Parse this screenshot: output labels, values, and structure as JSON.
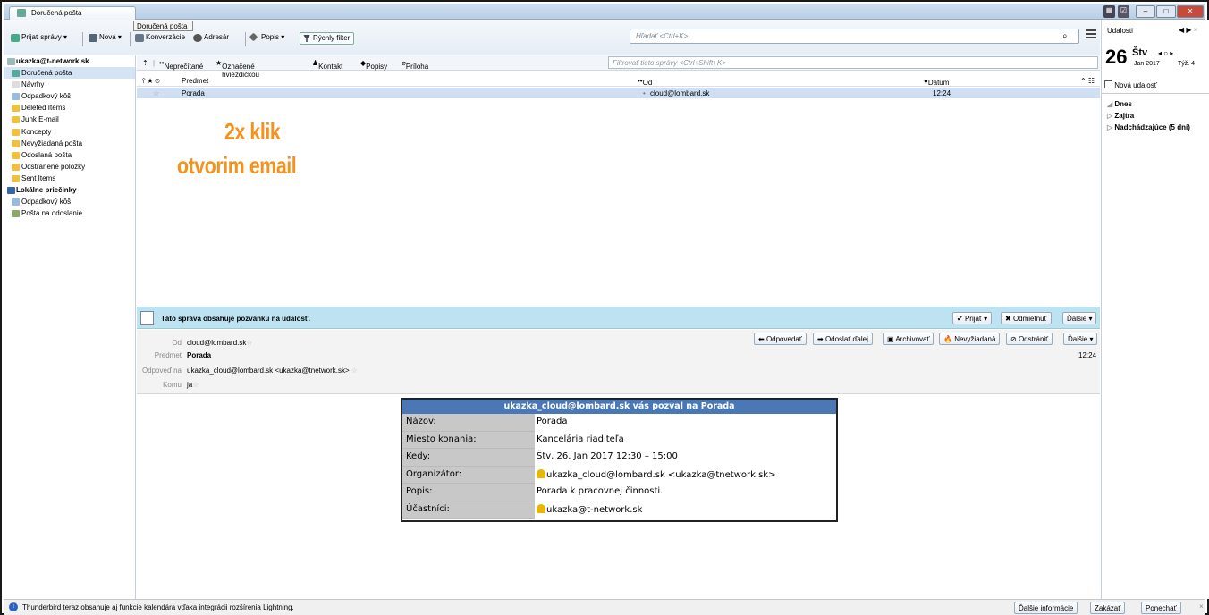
{
  "window": {
    "tab_title": "Doručená pošta",
    "tooltip": "Doručená pošta"
  },
  "toolbar": {
    "get_mail": "Prijať správy",
    "new": "Nová",
    "chat": "Konverzácie",
    "address_book": "Adresár",
    "tags": "Popis",
    "quick_filter": "Rýchly filter",
    "search_placeholder": "Hľadať <Ctrl+K>"
  },
  "folders": [
    {
      "label": "ukazka@t-network.sk",
      "type": "account"
    },
    {
      "label": "Doručená pošta",
      "type": "folder",
      "selected": true
    },
    {
      "label": "Návrhy",
      "type": "folder"
    },
    {
      "label": "Odpadkový kôš",
      "type": "folder"
    },
    {
      "label": "Deleted Items",
      "type": "folder"
    },
    {
      "label": "Junk E-mail",
      "type": "folder"
    },
    {
      "label": "Koncepty",
      "type": "folder"
    },
    {
      "label": "Nevyžiadaná pošta",
      "type": "folder"
    },
    {
      "label": "Odoslaná pošta",
      "type": "folder"
    },
    {
      "label": "Odstránené položky",
      "type": "folder"
    },
    {
      "label": "Sent Items",
      "type": "folder"
    },
    {
      "label": "Lokálne priečinky",
      "type": "account"
    },
    {
      "label": "Odpadkový kôš",
      "type": "folder"
    },
    {
      "label": "Pošta na odoslanie",
      "type": "folder"
    }
  ],
  "quickfilter": {
    "unread": "Neprečítané",
    "starred": "Označené hviezdičkou",
    "contact": "Kontakt",
    "tags": "Popisy",
    "attachment": "Príloha",
    "filter_placeholder": "Filtrovať tieto správy <Ctrl+Shift+K>"
  },
  "columns": {
    "subject": "Predmet",
    "from": "Od",
    "date": "Dátum"
  },
  "messages": [
    {
      "subject": "Porada",
      "from": "cloud@lombard.sk",
      "date": "12:24"
    }
  ],
  "annotation": {
    "line1": "2x klik",
    "line2": "otvorim email"
  },
  "invitation_bar": {
    "text": "Táto správa obsahuje pozvánku na udalosť.",
    "accept": "Prijať",
    "decline": "Odmietnuť",
    "more": "Ďalšie"
  },
  "header_actions": {
    "reply": "Odpovedať",
    "forward": "Odoslať ďalej",
    "archive": "Archivovať",
    "junk": "Nevyžiadaná",
    "delete": "Odstrániť",
    "more": "Ďalšie"
  },
  "message_header": {
    "from_label": "Od",
    "from": "cloud@lombard.sk",
    "subject_label": "Predmet",
    "subject": "Porada",
    "reply_to_label": "Odpoveď na",
    "reply_to": "ukazka_cloud@lombard.sk <ukazka@tnetwork.sk>",
    "to_label": "Komu",
    "to": "ja",
    "time": "12:24"
  },
  "invite": {
    "heading": "ukazka_cloud@lombard.sk vás pozval na Porada",
    "rows": [
      {
        "key": "Názov:",
        "value": "Porada"
      },
      {
        "key": "Miesto konania:",
        "value": "Kancelária riaditeľa"
      },
      {
        "key": "Kedy:",
        "value": "Štv, 26. Jan 2017 12:30 – 15:00"
      },
      {
        "key": "Organizátor:",
        "value": "ukazka_cloud@lombard.sk <ukazka@tnetwork.sk>"
      },
      {
        "key": "Popis:",
        "value": "Porada k pracovnej činnosti."
      },
      {
        "key": "Účastníci:",
        "value": "ukazka@t-network.sk"
      }
    ]
  },
  "today_pane": {
    "title": "Udalosti",
    "day": "26",
    "weekday": "Štv",
    "month_year": "Jan 2017",
    "week": "Týž. 4",
    "new_event": "Nová udalosť",
    "groups": [
      "Dnes",
      "Zajtra",
      "Nadchádzajúce (5 dní)"
    ]
  },
  "statusbar": {
    "message": "Thunderbird teraz obsahuje aj funkcie kalendára vďaka integrácii rozšírenia Lightning.",
    "more_info": "Ďalšie informácie",
    "disable": "Zakázať",
    "keep": "Ponechať"
  }
}
